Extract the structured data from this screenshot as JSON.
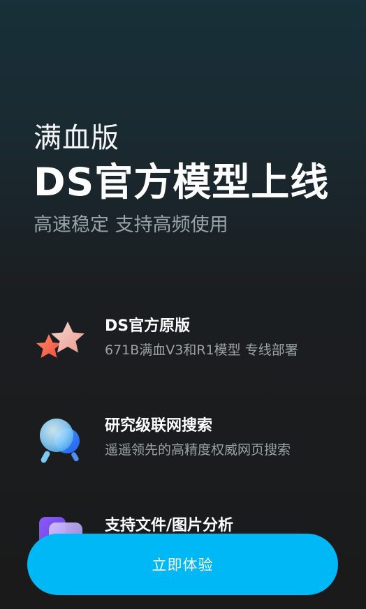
{
  "hero": {
    "kicker": "满血版",
    "title": "DS官方模型上线",
    "subtitle": "高速稳定 支持高频使用"
  },
  "features": [
    {
      "icon": "stars-icon",
      "title": "DS官方原版",
      "desc": "671B满血V3和R1模型 专线部署"
    },
    {
      "icon": "search-magnifier-icon",
      "title": "研究级联网搜索",
      "desc": "遥遥领先的高精度权威网页搜索"
    },
    {
      "icon": "file-stack-icon",
      "title": "支持文件/图片分析",
      "desc": ""
    }
  ],
  "cta": {
    "label": "立即体验"
  },
  "colors": {
    "accent": "#00b8f5",
    "background_top": "#173039",
    "background_bottom": "#1a1a1a",
    "muted_text": "#9aa3a6"
  }
}
